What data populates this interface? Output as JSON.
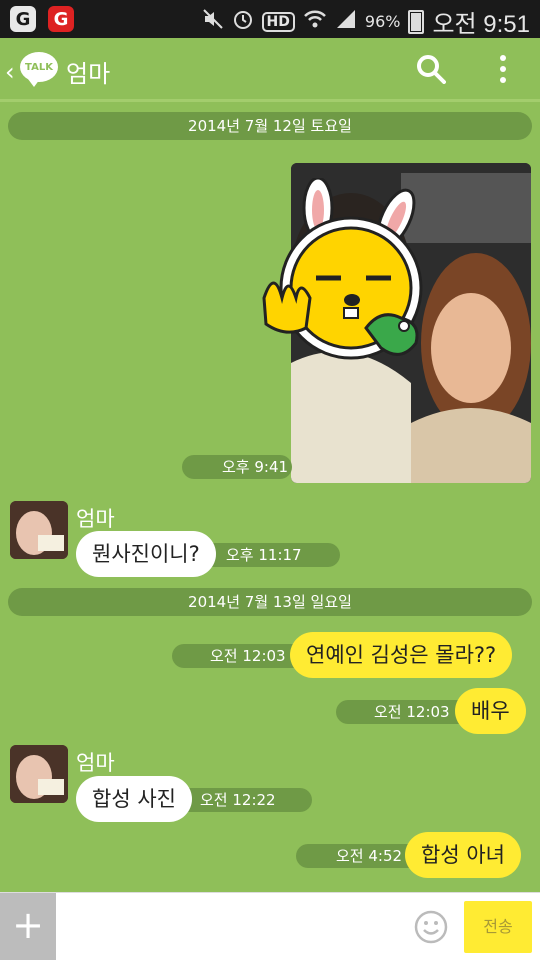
{
  "status_bar": {
    "battery": "96%",
    "time": "오전 9:51",
    "hd_label": "HD",
    "icons": [
      "mute-icon",
      "alarm-icon",
      "hd-voice-icon",
      "wifi-icon",
      "signal-icon",
      "battery-icon"
    ]
  },
  "header": {
    "logo_text": "TALK",
    "title": "엄마",
    "icons": [
      "back-icon",
      "search-icon",
      "more-menu-icon"
    ]
  },
  "chat": {
    "date_1": "2014년 7월 12일 토요일",
    "date_2": "2014년 7월 13일 일요일",
    "messages": [
      {
        "side": "me",
        "type": "photo",
        "time": "오후 9:41"
      },
      {
        "side": "other",
        "sender": "엄마",
        "text": "뭔사진이니?",
        "time": "오후 11:17"
      },
      {
        "side": "me",
        "text": "연예인 김성은 몰라??",
        "time": "오전 12:03"
      },
      {
        "side": "me",
        "text": "배우",
        "time": "오전 12:03"
      },
      {
        "side": "other",
        "sender": "엄마",
        "text": "합성 사진",
        "time": "오전 12:22"
      },
      {
        "side": "me",
        "text": "합성 아녀",
        "time": "오전 4:52"
      }
    ]
  },
  "input_bar": {
    "plus_label": "+",
    "message_placeholder": "",
    "send_label": "전송"
  },
  "colors": {
    "chat_bg": "#8fbf59",
    "my_bubble": "#ffeb33",
    "their_bubble": "#ffffff",
    "time_pill": "#6f9a46",
    "status_bar": "#1a1a1a"
  }
}
